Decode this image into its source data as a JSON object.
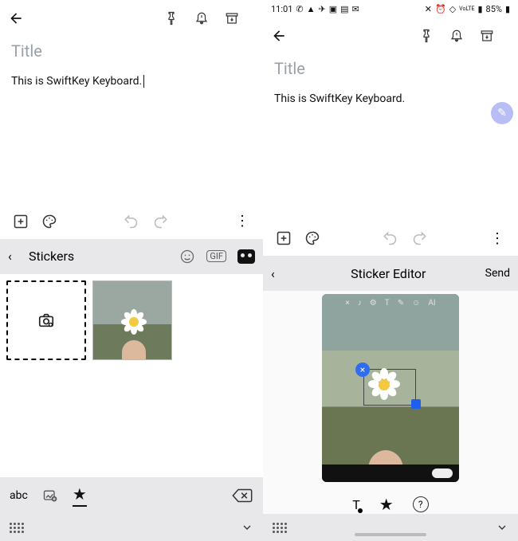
{
  "left": {
    "title_placeholder": "Title",
    "body": "This is SwiftKey Keyboard.",
    "stickers_label": "Stickers",
    "gif_label": "GIF",
    "abc_label": "abc"
  },
  "right": {
    "status_time": "11:01",
    "battery": "85%",
    "title_placeholder": "Title",
    "body": "This is SwiftKey Keyboard.",
    "editor_label": "Sticker Editor",
    "send_label": "Send",
    "help_label": "?"
  }
}
